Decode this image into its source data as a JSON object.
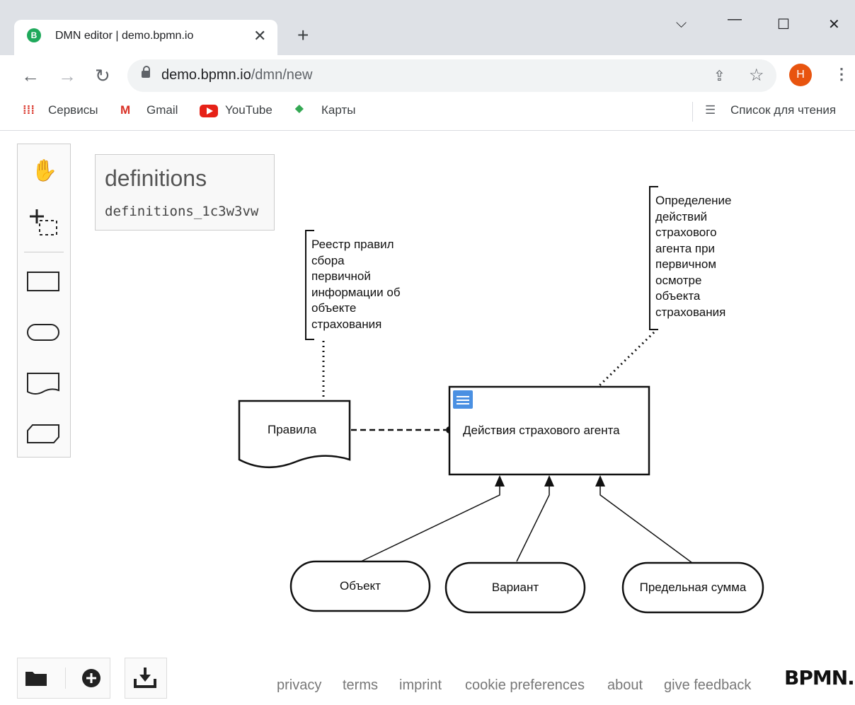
{
  "browser": {
    "tab_title": "DMN editor | demo.bpmn.io",
    "url_host": "demo.bpmn.io",
    "url_path": "/dmn/new",
    "avatar_letter": "H",
    "bookmarks": [
      "Сервисы",
      "Gmail",
      "YouTube",
      "Карты"
    ],
    "reading_list": "Список для чтения"
  },
  "definitions": {
    "name": "definitions",
    "id": "definitions_1c3w3vw"
  },
  "diagram": {
    "annotation_left": [
      "Реестр правил",
      "сбора",
      "первичной",
      "информации об",
      "объекте",
      "страхования"
    ],
    "annotation_right": [
      "Определение",
      "действий",
      "страхового",
      "агента при",
      "первичном",
      "осмотре",
      "объекта",
      "страхования"
    ],
    "knowledge_source": "Правила",
    "decision": "Действия страхового агента",
    "inputs": [
      "Объект",
      "Вариант",
      "Предельная сумма"
    ]
  },
  "footer": {
    "links": [
      "privacy",
      "terms",
      "imprint",
      "cookie preferences",
      "about",
      "give feedback"
    ],
    "logo": "BPMN.iO"
  },
  "icons": {
    "favicon": "bpmn-favicon-icon",
    "palette": [
      "hand-tool-icon",
      "lasso-tool-icon",
      "decision-icon",
      "input-data-icon",
      "knowledge-source-icon",
      "bkm-icon"
    ],
    "file": [
      "open-folder-icon",
      "new-diagram-icon",
      "download-icon"
    ]
  },
  "colors": {
    "avatar": "#e8540f",
    "favicon": "#1fa95b",
    "decision_badge": "#4a90e2"
  }
}
